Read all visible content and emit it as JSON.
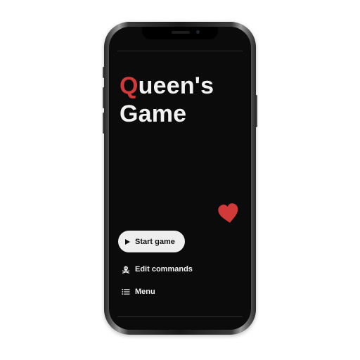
{
  "app": {
    "title_first_letter": "Q",
    "title_rest_line1": "ueen's",
    "title_line2": "Game"
  },
  "actions": {
    "start_label": "Start game",
    "edit_label": "Edit commands",
    "menu_label": "Menu"
  },
  "icons": {
    "start": "play-icon",
    "edit": "skull-crossbones-icon",
    "menu": "list-icon",
    "decoration": "heart-icon"
  },
  "colors": {
    "background": "#0b0b0c",
    "accent": "#d23a3a",
    "text": "#f2f2f2",
    "button_bg": "#eeeeee"
  }
}
